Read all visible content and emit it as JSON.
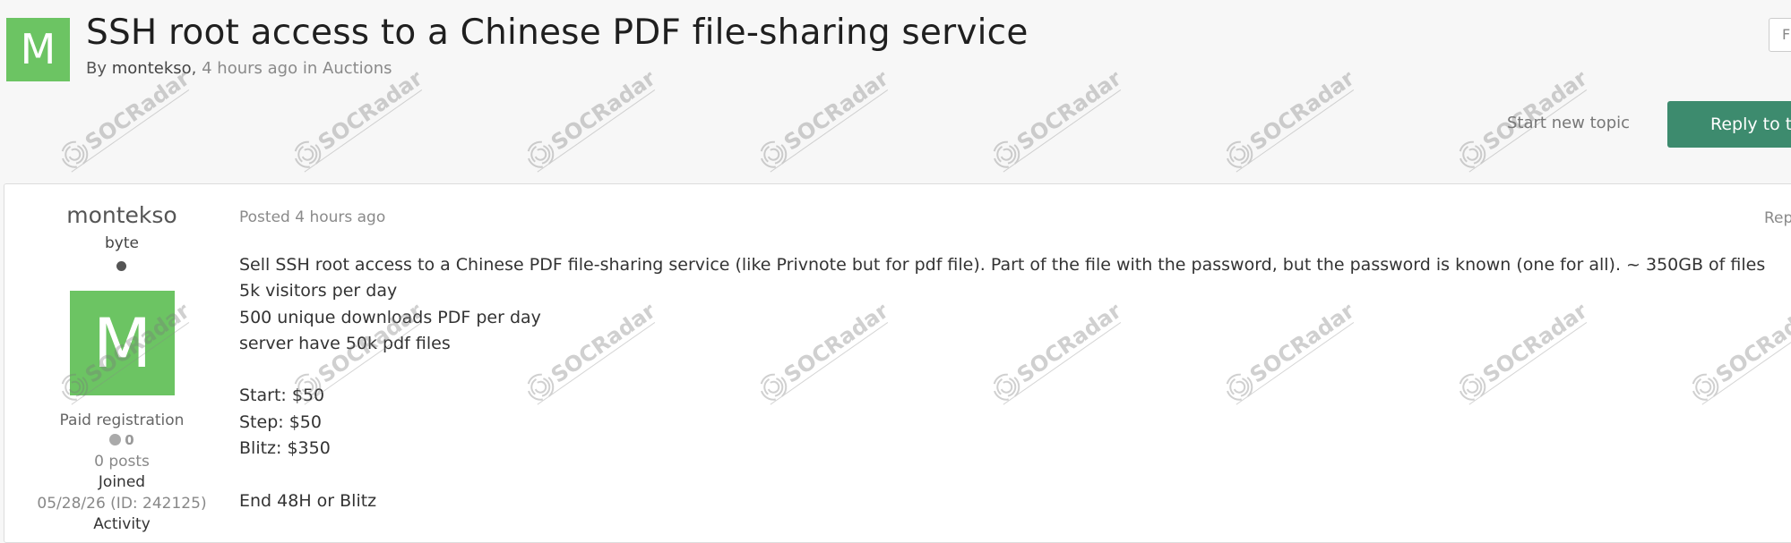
{
  "topic": {
    "avatar_letter": "M",
    "title": "SSH root access to a Chinese PDF file-sharing service",
    "by_label": "By",
    "author": "montekso",
    "separator": ",",
    "time_ago": "4 hours ago",
    "in_label": "in",
    "forum": "Auctions"
  },
  "actions": {
    "corner_button_text": "F",
    "start_new_topic": "Start new topic",
    "reply": "Reply to t"
  },
  "author": {
    "name": "montekso",
    "rank": "byte",
    "avatar_letter": "M",
    "group": "Paid registration",
    "reputation": "0",
    "posts": "0 posts",
    "joined_label": "Joined",
    "joined_value": "05/28/26 (ID: 242125)",
    "activity_label": "Activity"
  },
  "post": {
    "date": "Posted 4 hours ago",
    "report": "Rep",
    "lines": [
      "Sell SSH root access to a Chinese PDF file-sharing service (like Privnote but for pdf file). Part of the file with the password, but the password is known (one for all). ~ 350GB of files",
      "5k visitors per day",
      "500 unique downloads PDF per day",
      "server have 50k pdf files",
      "",
      "Start: $50",
      "Step: $50",
      "Blitz: $350",
      "",
      "End 48H or Blitz"
    ]
  },
  "watermark": {
    "text": "SOCRadar"
  },
  "colors": {
    "accent": "#3d8b6e",
    "avatar": "#6cc463",
    "link_muted": "#8a8a8a"
  }
}
